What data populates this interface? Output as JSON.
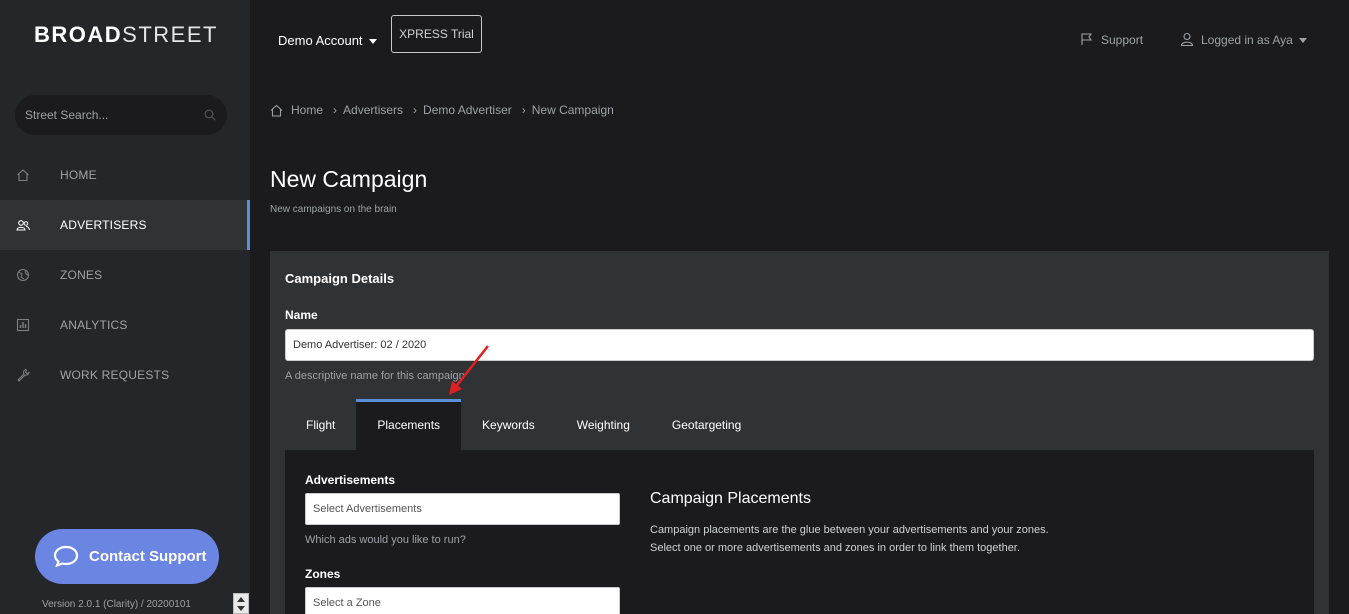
{
  "brand": {
    "logo_bold": "BROAD",
    "logo_rest": "STREET"
  },
  "search": {
    "placeholder": "Street Search..."
  },
  "sidebar": {
    "items": [
      {
        "label": "HOME",
        "icon": "home-icon"
      },
      {
        "label": "ADVERTISERS",
        "icon": "users-icon",
        "active": true
      },
      {
        "label": "ZONES",
        "icon": "globe-icon"
      },
      {
        "label": "ANALYTICS",
        "icon": "chart-icon"
      },
      {
        "label": "WORK REQUESTS",
        "icon": "wrench-icon"
      }
    ],
    "contact_label": "Contact Support",
    "version": "Version 2.0.1 (Clarity) / 20200101"
  },
  "topbar": {
    "account": "Demo Account",
    "xpress": "XPRESS Trial",
    "support": "Support",
    "user": "Logged in as Aya"
  },
  "breadcrumb": [
    "Home",
    "Advertisers",
    "Demo Advertiser",
    "New Campaign"
  ],
  "page": {
    "title": "New Campaign",
    "subtitle": "New campaigns on the brain"
  },
  "panel": {
    "title": "Campaign Details",
    "name_label": "Name",
    "name_value": "Demo Advertiser: 02 / 2020",
    "name_help": "A descriptive name for this campaign",
    "tabs": [
      "Flight",
      "Placements",
      "Keywords",
      "Weighting",
      "Geotargeting"
    ],
    "active_tab": "Placements",
    "ads_label": "Advertisements",
    "ads_placeholder": "Select Advertisements",
    "ads_help": "Which ads would you like to run?",
    "zones_label": "Zones",
    "zones_placeholder": "Select a Zone",
    "placements_title": "Campaign Placements",
    "placements_line1": "Campaign placements are the glue between your advertisements and your zones.",
    "placements_line2": "Select one or more advertisements and zones in order to link them together."
  },
  "colors": {
    "accent": "#5c90d6",
    "contact": "#6b85e3",
    "annotation": "#e02020"
  }
}
